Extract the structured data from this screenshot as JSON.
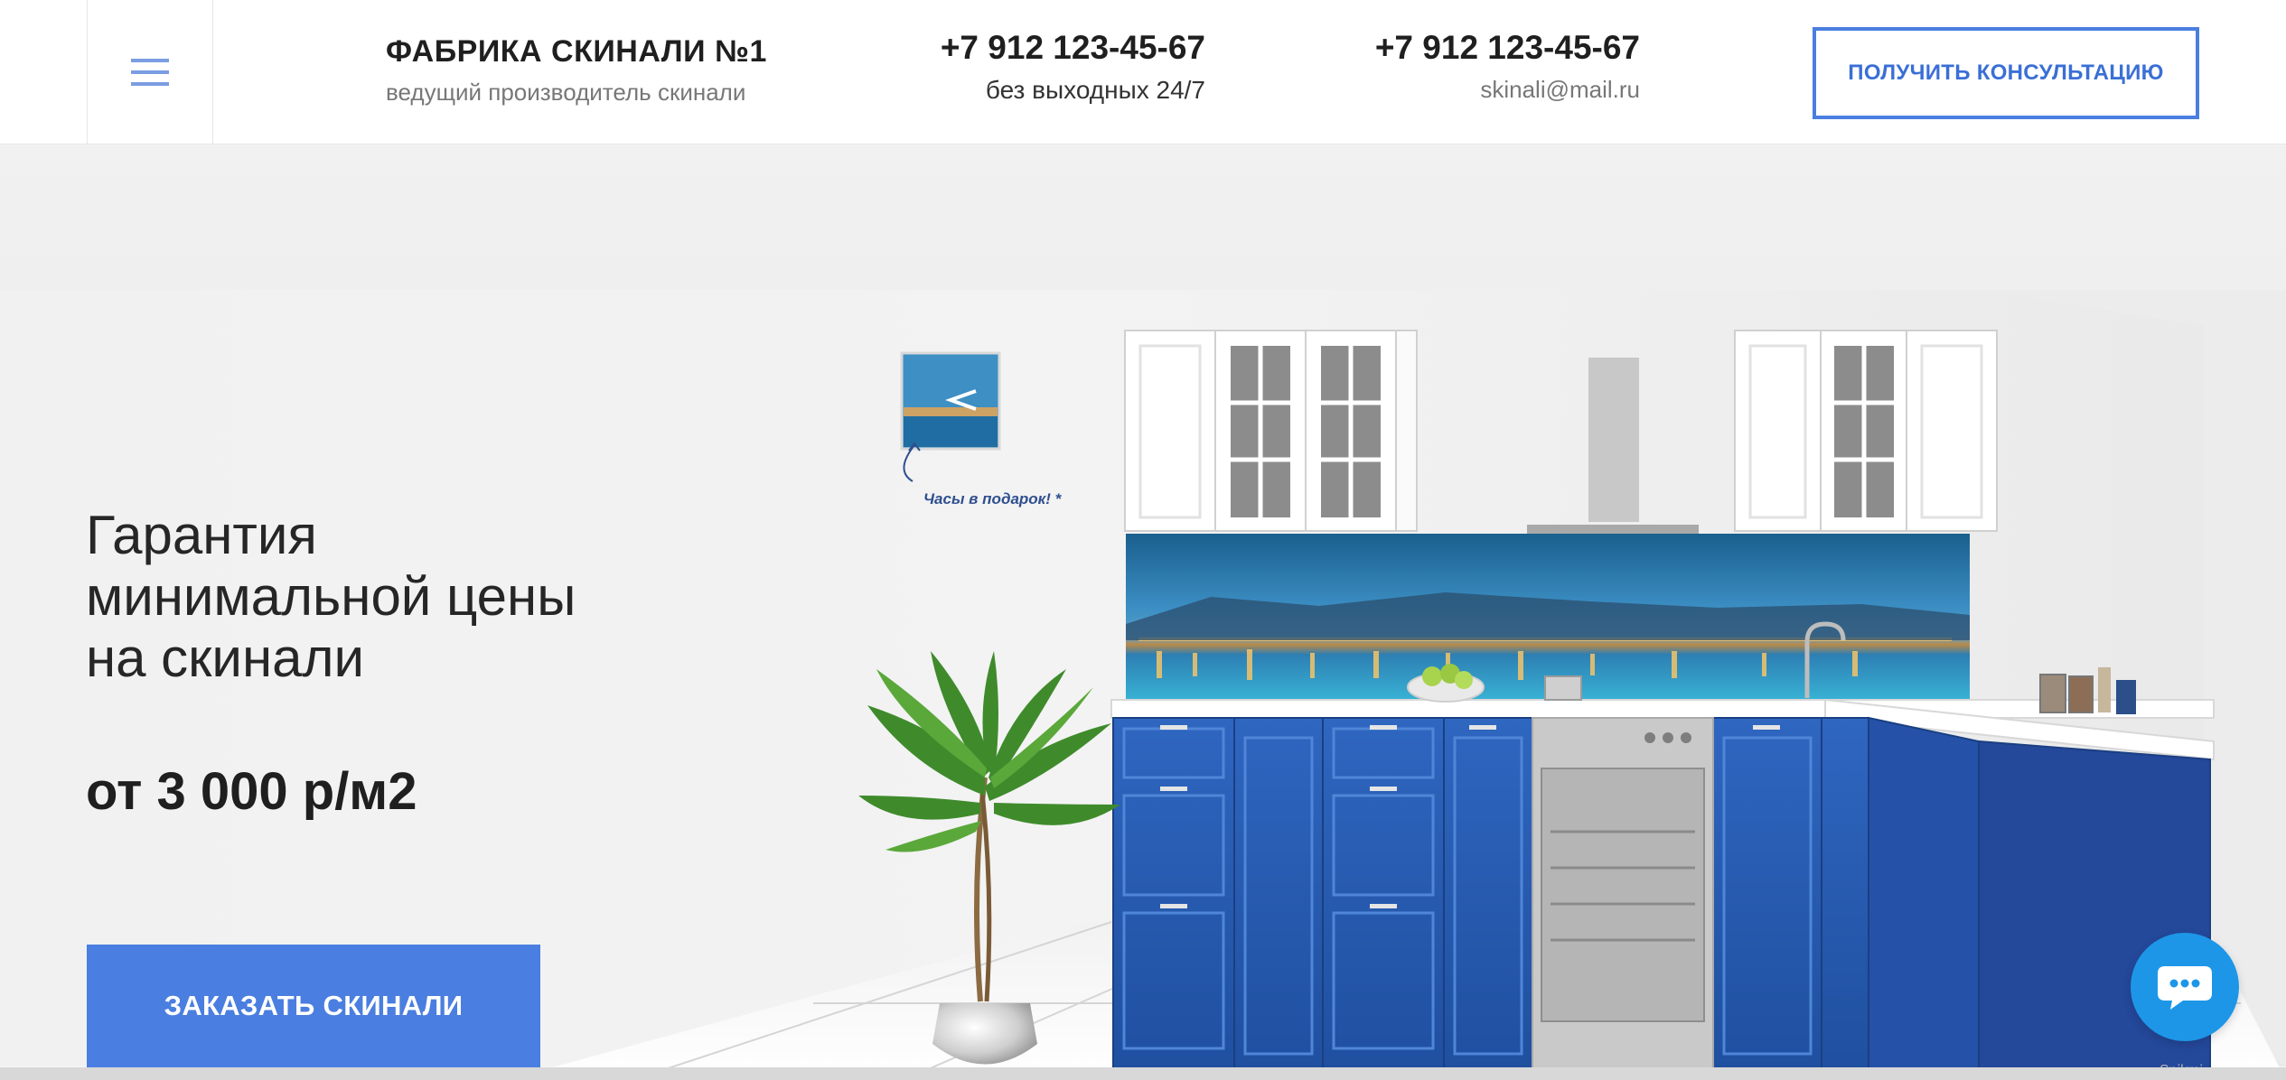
{
  "header": {
    "brand_title": "ФАБРИКА СКИНАЛИ №1",
    "brand_subtitle": "ведущий производитель скинали",
    "contact_1": {
      "phone": "+7 912 123-45-67",
      "note": "без выходных 24/7"
    },
    "contact_2": {
      "phone": "+7 912 123-45-67",
      "email": "skinali@mail.ru"
    },
    "cta_label": "ПОЛУЧИТЬ КОНСУЛЬТАЦИЮ"
  },
  "hero": {
    "headline_lines": [
      "Гарантия",
      "минимальной цены",
      "на скинали"
    ],
    "price": "от 3 000 р/м2",
    "order_button": "ЗАКАЗАТЬ СКИНАЛИ",
    "clock_note": "Часы в подарок! *"
  },
  "widget": {
    "brand": "Spikmi"
  },
  "icons": [
    "menu-icon",
    "chat-icon"
  ],
  "colors": {
    "accent": "#4a7ee0",
    "chat": "#1e96e8",
    "cabinet_blue": "#2a5db0"
  }
}
